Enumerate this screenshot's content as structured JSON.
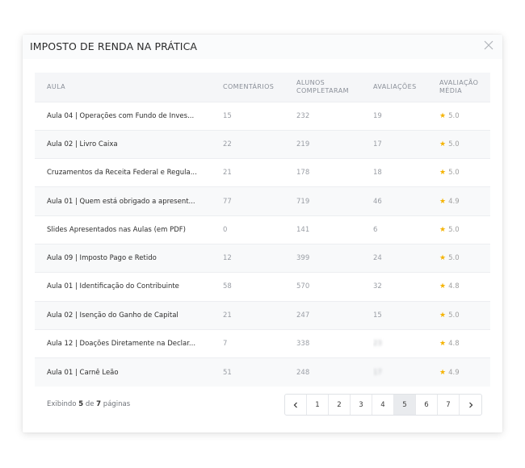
{
  "modal": {
    "title": "IMPOSTO DE RENDA NA PRÁTICA"
  },
  "table": {
    "headers": {
      "aula": "AULA",
      "comentarios": "COMENTÁRIOS",
      "alunos_1": "ALUNOS",
      "alunos_2": "COMPLETARAM",
      "avaliacoes": "AVALIAÇÕES",
      "media_1": "AVALIAÇÃO",
      "media_2": "MÉDIA"
    },
    "rows": [
      {
        "aula": "Aula 04 | Operações com Fundo de Inves...",
        "comentarios": "15",
        "alunos": "232",
        "avaliacoes": "19",
        "media": "5.0"
      },
      {
        "aula": "Aula 02 | Livro Caixa",
        "comentarios": "22",
        "alunos": "219",
        "avaliacoes": "17",
        "media": "5.0"
      },
      {
        "aula": "Cruzamentos da Receita Federal e Regula...",
        "comentarios": "21",
        "alunos": "178",
        "avaliacoes": "18",
        "media": "5.0"
      },
      {
        "aula": "Aula 01 | Quem está obrigado a apresent...",
        "comentarios": "77",
        "alunos": "719",
        "avaliacoes": "46",
        "media": "4.9"
      },
      {
        "aula": "Slides Apresentados nas Aulas (em PDF)",
        "comentarios": "0",
        "alunos": "141",
        "avaliacoes": "6",
        "media": "5.0"
      },
      {
        "aula": "Aula 09 | Imposto Pago e Retido",
        "comentarios": "12",
        "alunos": "399",
        "avaliacoes": "24",
        "media": "5.0"
      },
      {
        "aula": "Aula 01 | Identificação do Contribuinte",
        "comentarios": "58",
        "alunos": "570",
        "avaliacoes": "32",
        "media": "4.8"
      },
      {
        "aula": "Aula 02 | Isenção do Ganho de Capital",
        "comentarios": "21",
        "alunos": "247",
        "avaliacoes": "15",
        "media": "5.0"
      },
      {
        "aula": "Aula 12 | Doações Diretamente na Declar...",
        "comentarios": "7",
        "alunos": "338",
        "avaliacoes": "23",
        "media": "4.8"
      },
      {
        "aula": "Aula 01 | Carnê Leão",
        "comentarios": "51",
        "alunos": "248",
        "avaliacoes": "17",
        "media": "4.9"
      }
    ]
  },
  "footer": {
    "info_prefix": "Exibindo",
    "current_page": "5",
    "info_mid": "de",
    "total_pages": "7",
    "info_suffix": "páginas"
  },
  "pagination": {
    "pages": [
      "1",
      "2",
      "3",
      "4",
      "5",
      "6",
      "7"
    ],
    "active": "5"
  },
  "colors": {
    "star": "#f5b301",
    "accent_active_page": "#e9ebee"
  },
  "icons": {
    "close": "close-icon",
    "star": "star-icon",
    "prev": "chevron-left-icon",
    "next": "chevron-right-icon"
  }
}
